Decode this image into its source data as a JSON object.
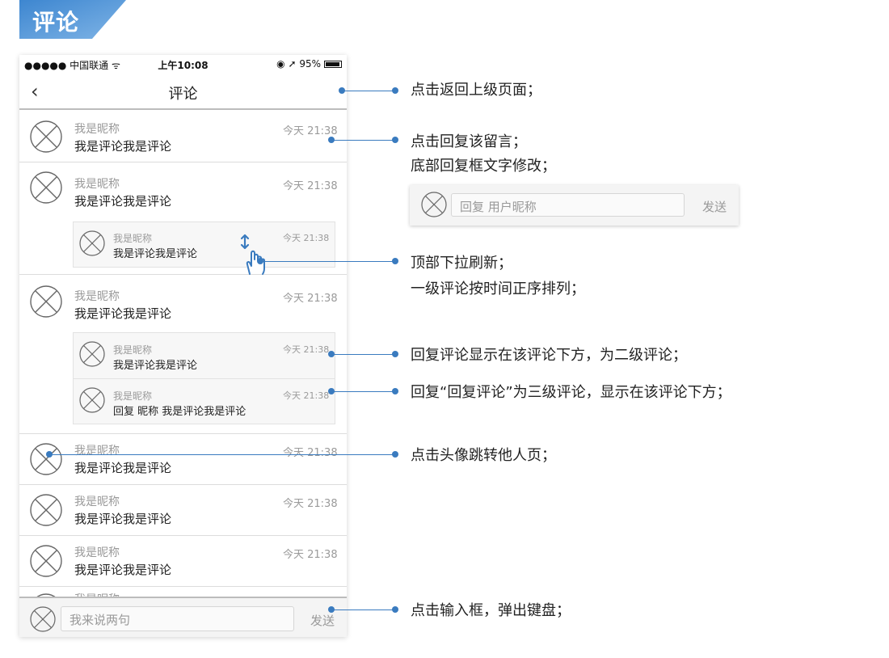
{
  "header": {
    "title": "评论"
  },
  "statusbar": {
    "carrier": "●●●●● 中国联通 ᯤ",
    "time": "上午10:08",
    "battery": "◉ ➚ 95%"
  },
  "navbar": {
    "back": "‹",
    "title": "评论"
  },
  "comments": [
    {
      "nick": "我是昵称",
      "content": "我是评论我是评论",
      "time": "今天 21:38"
    },
    {
      "nick": "我是昵称",
      "content": "我是评论我是评论",
      "time": "今天 21:38",
      "replies": [
        {
          "nick": "我是昵称",
          "content": "我是评论我是评论",
          "time": "今天 21:38"
        }
      ]
    },
    {
      "nick": "我是昵称",
      "content": "我是评论我是评论",
      "time": "今天 21:38",
      "replies": [
        {
          "nick": "我是昵称",
          "content": "我是评论我是评论",
          "time": "今天 21:38"
        },
        {
          "nick": "我是昵称",
          "content": "回复 昵称 我是评论我是评论",
          "time": "今天 21:38"
        }
      ]
    },
    {
      "nick": "我是昵称",
      "content": "我是评论我是评论",
      "time": "今天 21:38"
    },
    {
      "nick": "我是昵称",
      "content": "我是评论我是评论",
      "time": "今天 21:38"
    },
    {
      "nick": "我是昵称",
      "content": "我是评论我是评论",
      "time": "今天 21:38"
    },
    {
      "nick": "我是昵称"
    }
  ],
  "inputbar": {
    "placeholder": "我来说两句",
    "send": "发送"
  },
  "reply_sample": {
    "placeholder": "回复 用户昵称",
    "send": "发送"
  },
  "annotations": [
    "点击返回上级页面；",
    "点击回复该留言；",
    "底部回复框文字修改；",
    "顶部下拉刷新；",
    "一级评论按时间正序排列；",
    "回复评论显示在该评论下方，为二级评论；",
    "回复“回复评论”为三级评论，显示在该评论下方；",
    "点击头像跳转他人页；",
    "点击输入框，弹出键盘；"
  ],
  "colors": {
    "accent": "#3a7bbf",
    "badge": "#3d86d0"
  }
}
